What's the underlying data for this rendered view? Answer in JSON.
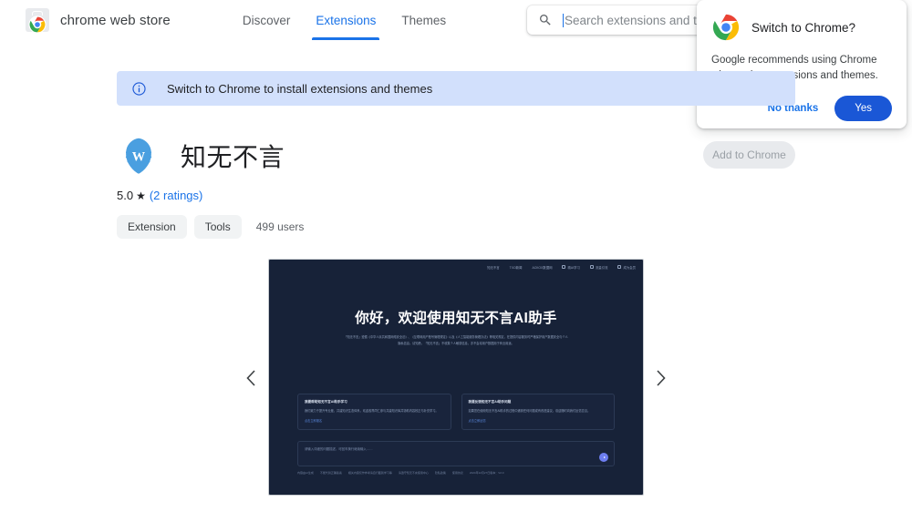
{
  "header": {
    "brand": "chrome web store",
    "logo_icon": "chrome-web-store-logo",
    "nav": [
      {
        "label": "Discover",
        "active": false
      },
      {
        "label": "Extensions",
        "active": true
      },
      {
        "label": "Themes",
        "active": false
      }
    ]
  },
  "search": {
    "icon": "search-icon",
    "placeholder": "Search extensions and themes",
    "value": ""
  },
  "dialog": {
    "icon": "chrome-logo-icon",
    "title": "Switch to Chrome?",
    "body": "Google recommends using Chrome when using extensions and themes.",
    "decline_label": "No thanks",
    "accept_label": "Yes",
    "accent_color": "#1a57d6",
    "link_color": "#1a73e8"
  },
  "banner": {
    "icon": "info-icon",
    "text": "Switch to Chrome to install extensions and themes",
    "background_color": "#d2e0fc",
    "icon_color": "#1a73e8"
  },
  "extension": {
    "icon": "laurel-wreath-w-icon",
    "name": "知无不言",
    "rating_value": "5.0",
    "star_glyph": "★",
    "rating_count_text": "(2 ratings)",
    "chips": [
      "Extension",
      "Tools"
    ],
    "users": "499 users",
    "install_button": "Add to Chrome"
  },
  "carousel": {
    "prev_icon": "chevron-left-icon",
    "next_icon": "chevron-right-icon",
    "screenshot": {
      "background_color": "#172238",
      "nav_items": [
        "知无不言",
        "TXO新闻",
        "ACKOX数据网",
        "精AI学习",
        "流量引流",
        "成为会员"
      ],
      "title": "你好，欢迎使用知无不言AI助手",
      "subtitle": "「知无不言」遵循《中华人民共和国网络安全法》、《互联网用户账号管理规定》以及《人工智能服务管理办法》等相关规定，在提供内容服务时严格保护用户数据安全与个人隐私信息。请知悉，「知无不言」不收集个人敏感信息，亦不会将用户数据用于商业用途。",
      "cards": [
        {
          "title": "我要帮助知无不言AI助手学习",
          "body": "我们致力于提升专业度，共建知识生态体系，欢迎各界同仁参与共建知识库并协助内容校正与补充学习。",
          "link": "点击立即报名"
        },
        {
          "title": "我要反馈知无不言AI助手问题",
          "body": "如果您在使用知无不言AI助手的过程中遇到任何问题或有改进建议，欢迎随时向我们反馈意见。",
          "link": "点击立即反馈"
        }
      ],
      "input_placeholder": "请输入详细的问题描述，可回车换行继续输入……",
      "send_icon": "send-icon",
      "footer_items": [
        "内容由AI生成",
        "不能代替正确答案",
        "相关内容仅作参考请自行甄别学习等",
        "请遵守知无不言使用中心",
        "隐私政策",
        "使用协议",
        "2024年12月27日版本：V2.0"
      ]
    }
  }
}
